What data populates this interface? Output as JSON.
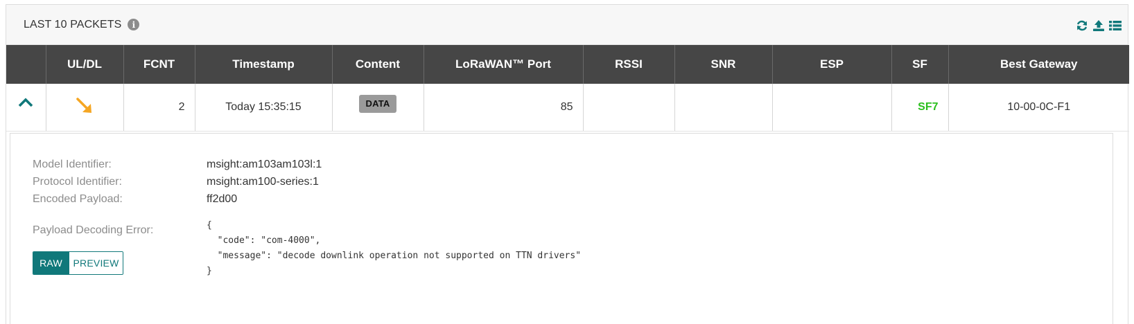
{
  "panel": {
    "title": "LAST 10 PACKETS",
    "info_icon": "info-circle-icon",
    "tools": [
      {
        "icon": "refresh-icon"
      },
      {
        "icon": "upload-icon"
      },
      {
        "icon": "list-icon"
      }
    ]
  },
  "table": {
    "headers": {
      "expand": "",
      "uldl": "UL/DL",
      "fcnt": "FCNT",
      "timestamp": "Timestamp",
      "content": "Content",
      "port": "LoRaWAN™ Port",
      "rssi": "RSSI",
      "snr": "SNR",
      "esp": "ESP",
      "sf": "SF",
      "gateway": "Best Gateway"
    },
    "rows": [
      {
        "expand_icon": "chevron-up-icon",
        "direction_icon": "arrow-down-right-icon",
        "fcnt": "2",
        "timestamp": "Today 15:35:15",
        "content": "DATA",
        "port": "85",
        "rssi": "",
        "snr": "",
        "esp": "",
        "sf": "SF7",
        "gateway": "10-00-0C-F1"
      }
    ]
  },
  "detail": {
    "model_label": "Model Identifier:",
    "model_value": "msight:am103am103l:1",
    "protocol_label": "Protocol Identifier:",
    "protocol_value": "msight:am100-series:1",
    "payload_label": "Encoded Payload:",
    "payload_value": "ff2d00",
    "error_label": "Payload Decoding Error:",
    "error_json": "{\n  \"code\": \"com-4000\",\n  \"message\": \"decode downlink operation not supported on TTN drivers\"\n}",
    "view_buttons": {
      "raw": "RAW",
      "preview": "PREVIEW",
      "active": "RAW"
    }
  },
  "colors": {
    "header_bg": "#464646",
    "accent_teal": "#10787a",
    "sf_green": "#2bbf1e",
    "direction_orange": "#f5a623",
    "badge_gray": "#9a9a9a"
  }
}
